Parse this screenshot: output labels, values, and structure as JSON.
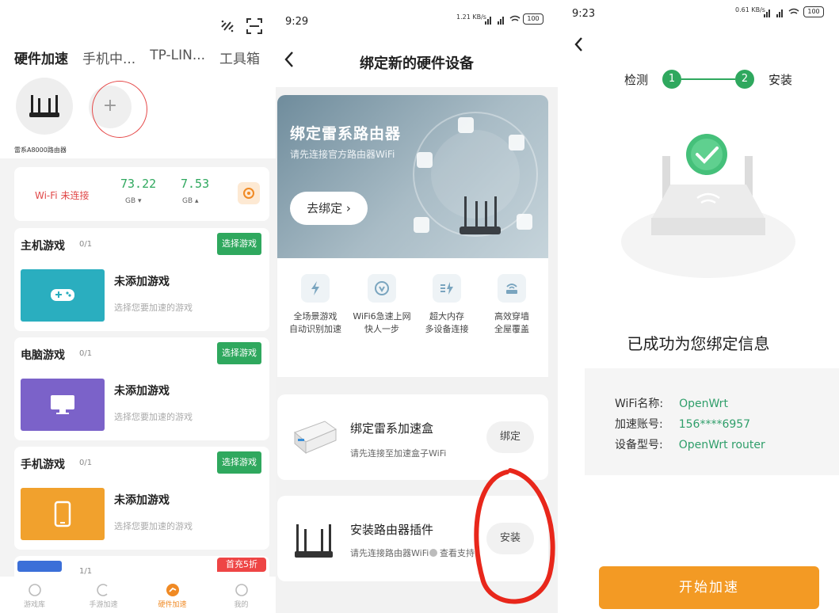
{
  "panel1": {
    "tabs": [
      "硬件加速",
      "手机中...",
      "TP-LIN...",
      "工具箱"
    ],
    "device_label": "雷系A8000路由器",
    "add_symbol": "+",
    "wifi_status": "Wi-Fi 未连接",
    "download": "73.22",
    "download_unit": "GB ▾",
    "upload": "7.53",
    "upload_unit": "GB ▴",
    "sections": [
      {
        "title": "主机游戏",
        "count": "0/1",
        "button": "选择游戏",
        "main": "未添加游戏",
        "sub": "选择您要加速的游戏",
        "color": "#2aaebf"
      },
      {
        "title": "电脑游戏",
        "count": "0/1",
        "button": "选择游戏",
        "main": "未添加游戏",
        "sub": "选择您要加速的游戏",
        "color": "#7b62c9"
      },
      {
        "title": "手机游戏",
        "count": "0/1",
        "button": "选择游戏",
        "main": "未添加游戏",
        "sub": "选择您要加速的游戏",
        "color": "#f1a12d"
      }
    ],
    "partial_section": {
      "count": "1/1",
      "badge": "首充5折"
    },
    "nav": [
      "游戏库",
      "手游加速",
      "硬件加速",
      "我的"
    ],
    "accent": "#f08a24",
    "green": "#2fa85e"
  },
  "panel2": {
    "time": "9:29",
    "net_speed": "1.21 KB/s",
    "battery": "100",
    "title": "绑定新的硬件设备",
    "banner_title": "绑定雷系路由器",
    "banner_sub": "请先连接官方路由器WiFi",
    "banner_btn": "去绑定 ›",
    "features": [
      {
        "line1": "全场景游戏",
        "line2": "自动识别加速"
      },
      {
        "line1": "WiFi6急速上网",
        "line2": "快人一步"
      },
      {
        "line1": "超大内存",
        "line2": "多设备连接"
      },
      {
        "line1": "高效穿墙",
        "line2": "全屋覆盖"
      }
    ],
    "box_title": "绑定雷系加速盒",
    "box_sub": "请先连接至加速盒子WiFi",
    "box_btn": "绑定",
    "plugin_title": "安装路由器插件",
    "plugin_sub": "请先连接路由器WiFi",
    "plugin_help": "查看支持",
    "plugin_btn": "安装"
  },
  "panel3": {
    "time": "9:23",
    "net_speed": "0.61 KB/s",
    "battery": "100",
    "step1_label": "检测",
    "step1_num": "1",
    "step2_num": "2",
    "step2_label": "安装",
    "success": "已成功为您绑定信息",
    "info": [
      {
        "label": "WiFi名称:",
        "value": "OpenWrt"
      },
      {
        "label": "加速账号:",
        "value": "156****6957"
      },
      {
        "label": "设备型号:",
        "value": "OpenWrt router"
      }
    ],
    "start_btn": "开始加速",
    "green": "#2fa85e",
    "orange": "#f39a24"
  }
}
